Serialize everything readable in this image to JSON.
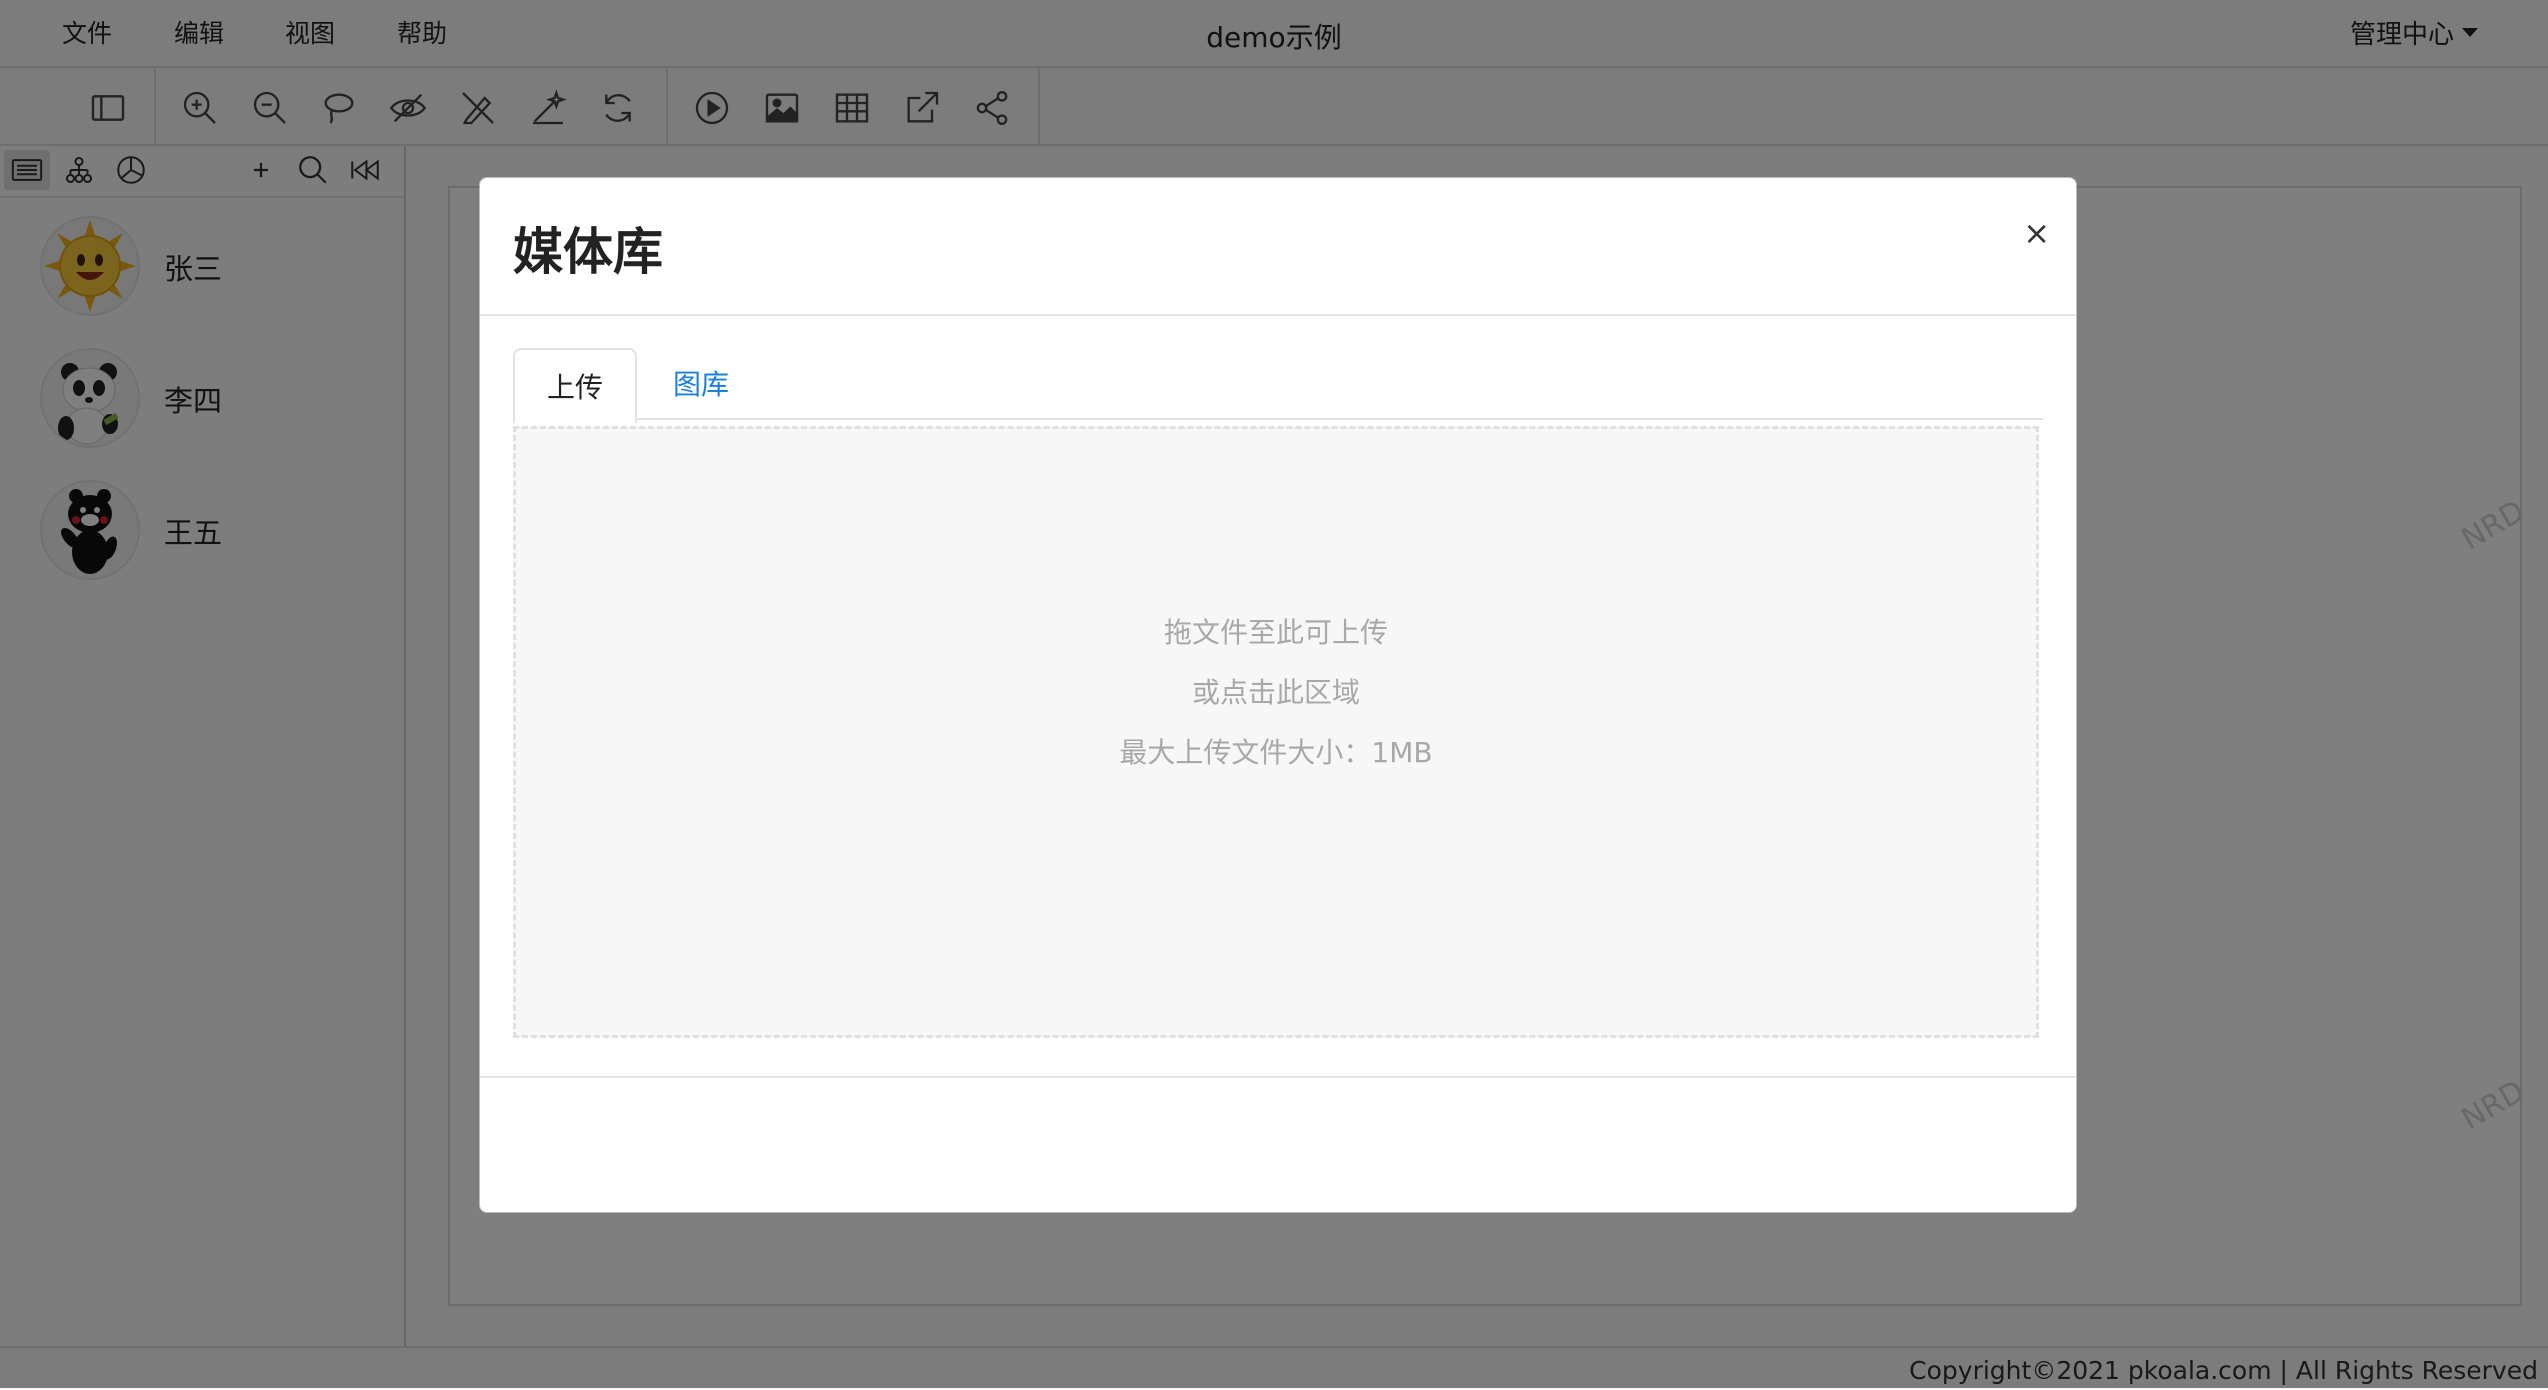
{
  "menu": {
    "items": [
      {
        "label": "文件"
      },
      {
        "label": "编辑"
      },
      {
        "label": "视图"
      },
      {
        "label": "帮助"
      }
    ]
  },
  "app": {
    "title": "demo示例",
    "admin_label": "管理中心"
  },
  "toolbar": {
    "groups": [
      [
        "sidebar-toggle-icon"
      ],
      [
        "zoom-in-icon",
        "zoom-out-icon",
        "lasso-icon",
        "hide-icon",
        "pencil-off-icon",
        "wand-icon",
        "refresh-icon"
      ],
      [
        "play-icon",
        "image-icon",
        "table-icon",
        "export-icon",
        "share-icon"
      ]
    ]
  },
  "sidebar": {
    "tools": [
      "list-view-icon",
      "tree-view-icon",
      "pie-chart-icon",
      "add-icon",
      "search-icon",
      "first-icon"
    ],
    "contacts": [
      {
        "name": "张三",
        "avatar": "sun-avatar"
      },
      {
        "name": "李四",
        "avatar": "panda-avatar"
      },
      {
        "name": "王五",
        "avatar": "bear-avatar"
      }
    ]
  },
  "watermark": {
    "text": "NRD"
  },
  "footer": {
    "copyright": "Copyright©2021 pkoala.com | All Rights Reserved"
  },
  "modal": {
    "title": "媒体库",
    "close": "×",
    "tabs": [
      {
        "label": "上传",
        "active": true
      },
      {
        "label": "图库",
        "active": false
      }
    ],
    "dropzone": {
      "line1": "拖文件至此可上传",
      "line2": "或点击此区域",
      "line3": "最大上传文件大小：1MB"
    }
  },
  "colors": {
    "link": "#1b7fe0",
    "backdrop": "rgba(0,0,0,0.5)"
  }
}
